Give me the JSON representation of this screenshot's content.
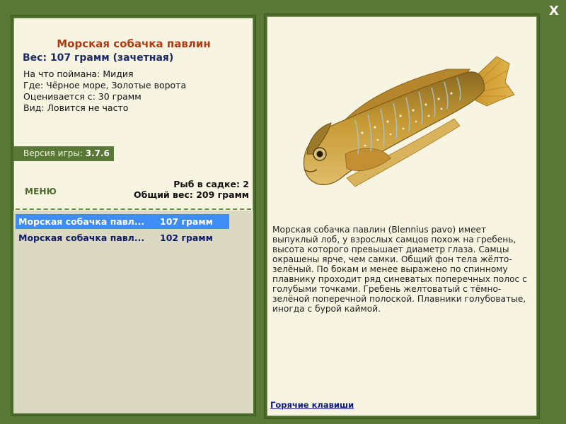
{
  "fish": {
    "title": "Морская собачка павлин",
    "weight": "Вес: 107 грамм (зачетная)",
    "caught_with": "На что поймана: Мидия",
    "where": "Где: Чёрное море, Золотые ворота",
    "valued_from": "Оценивается с: 30 грамм",
    "kind": "Вид: Ловится не часто",
    "description": "Морская собачка павлин (Blennius pavo) имеет выпуклый лоб, у взрослых самцов похож на гребень, высота которого превышает диаметр глаза. Самцы окрашены ярче, чем самки. Общий фон тела жёлто-зелёный. По бокам и менее выражено по спинному плавнику проходит ряд синеватых поперечных полос с голубыми точками. Гребень желтоватый с тёмно-зелёной поперечной полоской. Плавники голубоватые, иногда с бурой каймой."
  },
  "version": {
    "label": "Версия игры:",
    "value": "3.7.6"
  },
  "menu": {
    "label": "МЕНЮ"
  },
  "stats": {
    "fish_in_keepnet": "Рыб в садке: 2",
    "total_weight": "Общий вес: 209 грамм"
  },
  "catch_list": [
    {
      "name": "Морская собачка павл...",
      "weight": "107 грамм",
      "selected": true
    },
    {
      "name": "Морская собачка павл...",
      "weight": "102 грамм",
      "selected": false
    }
  ],
  "hotkeys": {
    "label": "Горячие клавиши"
  },
  "close": {
    "label": "X"
  },
  "colors": {
    "frame_green": "#5a7936",
    "panel_bg": "#f7f4e2",
    "title_red": "#b03a12",
    "weight_navy": "#1a2a6a",
    "selection_blue": "#3e8cf5",
    "list_bg": "#dcd9c2"
  },
  "icons": {
    "close": "close-icon",
    "fish": "fish-image"
  }
}
